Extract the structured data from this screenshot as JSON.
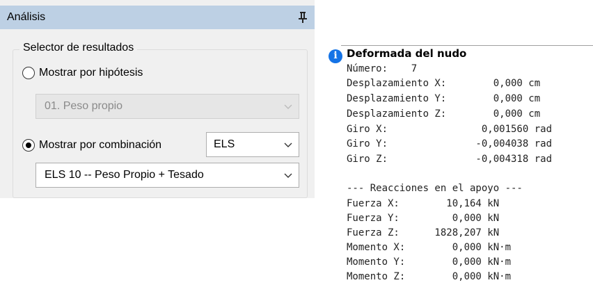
{
  "panel": {
    "title": "Análisis",
    "group_label": "Selector de resultados",
    "option_hypothesis": {
      "label": "Mostrar por hipótesis",
      "selected": false
    },
    "hypothesis_select": {
      "value": "01. Peso propio",
      "enabled": false
    },
    "option_combination": {
      "label": "Mostrar por combinación",
      "selected": true
    },
    "combination_type_select": {
      "value": "ELS"
    },
    "combination_select": {
      "value": "ELS 10 -- Peso Propio + Tesado"
    }
  },
  "info": {
    "title": "Deformada del nudo",
    "lines": [
      "Número:    7",
      "Desplazamiento X:        0,000 cm",
      "Desplazamiento Y:        0,000 cm",
      "Desplazamiento Z:        0,000 cm",
      "Giro X:                0,001560 rad",
      "Giro Y:               -0,004038 rad",
      "Giro Z:               -0,004318 rad",
      "",
      "--- Reacciones en el apoyo ---",
      "Fuerza X:        10,164 kN",
      "Fuerza Y:         0,000 kN",
      "Fuerza Z:      1828,207 kN",
      "Momento X:        0,000 kN·m",
      "Momento Y:        0,000 kN·m",
      "Momento Z:        0,000 kN·m"
    ]
  },
  "colors": {
    "header_bg": "#bdd0e4",
    "panel_bg": "#f0f0f0",
    "info_icon": "#1473e6"
  },
  "icons": {
    "pin": "pin-icon",
    "info": "info-icon",
    "dropdown": "chevron-down-icon"
  }
}
